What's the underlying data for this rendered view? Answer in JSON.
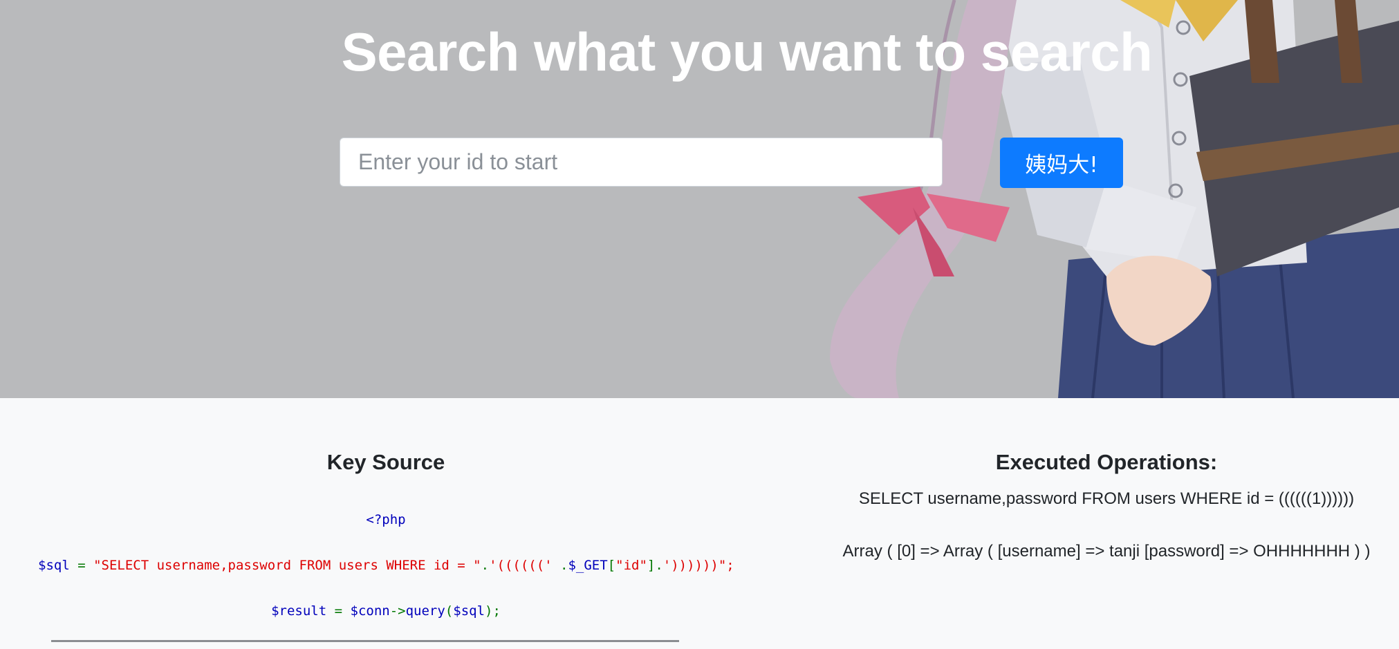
{
  "hero": {
    "title": "Search what you want to search",
    "search_placeholder": "Enter your id to start",
    "search_button": "姨妈大!"
  },
  "source": {
    "heading": "Key Source",
    "php_open": "<?php",
    "sql_line": {
      "var": "$sql",
      "eq": " = ",
      "str1": "\"SELECT username,password FROM users WHERE id = \"",
      "dot1": ".",
      "str2": "'((((((' ",
      "dot2": ".",
      "get": "$_GET",
      "bracket_open": "[",
      "key": "\"id\"",
      "bracket_close": "]",
      "dot3": ".",
      "str3": "'))))))\";"
    },
    "result_line": {
      "var": "$result",
      "eq": " = ",
      "conn": "$conn",
      "arrow": "->",
      "method": "query",
      "paren_open": "(",
      "arg": "$sql",
      "paren_close": ");"
    }
  },
  "executed": {
    "heading": "Executed Operations:",
    "query": "SELECT username,password FROM users WHERE id = ((((((1))))))",
    "result": "Array ( [0] => Array ( [username] => tanji [password] => OHHHHHHH ) )"
  },
  "colors": {
    "hero_bg": "#b9babc",
    "button": "#0d7bff",
    "php_var": "#0000bb",
    "php_op": "#007700",
    "php_str": "#dd0000"
  },
  "icons": [
    "anime-girl-illustration"
  ]
}
